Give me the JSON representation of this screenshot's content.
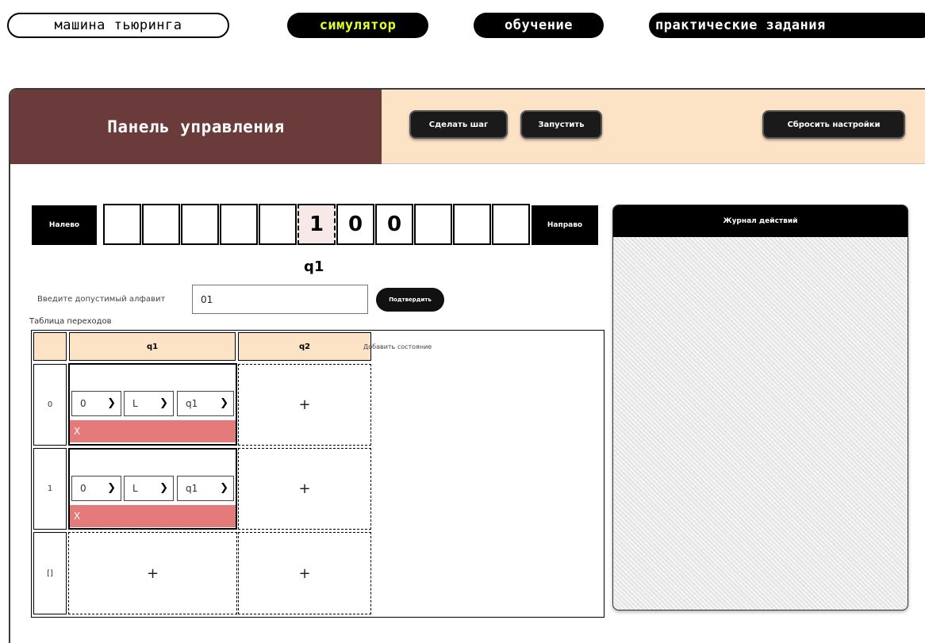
{
  "nav": {
    "brand": "машина тьюринга",
    "items": [
      {
        "label": "симулятор"
      },
      {
        "label": "обучение"
      },
      {
        "label": "практические задания"
      }
    ]
  },
  "panel": {
    "title": "Панель управления",
    "step_label": "Сделать шаг",
    "run_label": "Запустить",
    "reset_label": "Сбросить настройки"
  },
  "tape": {
    "left_label": "Налево",
    "right_label": "Направо",
    "cells": [
      "",
      "",
      "",
      "",
      "",
      "1",
      "0",
      "0",
      "",
      "",
      ""
    ],
    "current_index": 5,
    "state": "q1"
  },
  "alphabet": {
    "label": "Введите допустимый алфавит",
    "value": "01",
    "confirm_label": "Подтвердить"
  },
  "table": {
    "label": "Таблица переходов",
    "add_state_label": "Добавить состояние",
    "columns": [
      "q1",
      "q2"
    ],
    "rows": [
      "0",
      "1",
      "[]"
    ],
    "cells": [
      {
        "write": "0",
        "move": "L",
        "next": "q1",
        "delete_label": "X"
      },
      {
        "write": "0",
        "move": "L",
        "next": "q1",
        "delete_label": "X"
      }
    ],
    "add_symbol": "+"
  },
  "log": {
    "title": "Журнал действий"
  },
  "colors": {
    "panel_title_bg": "#6b3a3a",
    "header_bg": "#fde3c6",
    "accent_text": "#e8ff2a",
    "delete_bg": "#e57a7a"
  }
}
